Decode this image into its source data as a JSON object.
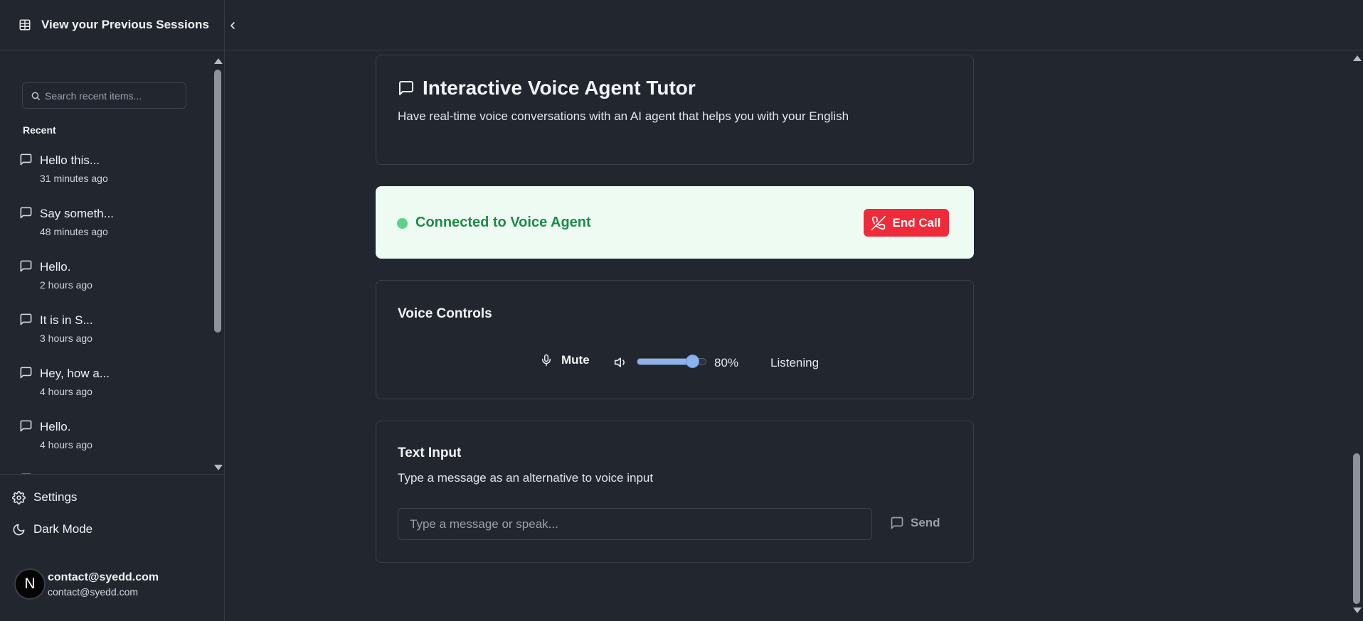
{
  "sidebar": {
    "header_title": "View your Previous Sessions",
    "search_placeholder": "Search recent items...",
    "recent_label": "Recent",
    "recent_items": [
      {
        "title": "Hello this...",
        "time": "31 minutes ago"
      },
      {
        "title": "Say someth...",
        "time": "48 minutes ago"
      },
      {
        "title": "Hello.",
        "time": "2 hours ago"
      },
      {
        "title": "It is in S...",
        "time": "3 hours ago"
      },
      {
        "title": "Hey, how a...",
        "time": "4 hours ago"
      },
      {
        "title": "Hello.",
        "time": "4 hours ago"
      }
    ],
    "settings_label": "Settings",
    "dark_mode_label": "Dark Mode",
    "user": {
      "avatar_initial": "N",
      "name": "contact@syedd.com",
      "email": "contact@syedd.com"
    }
  },
  "header_card": {
    "title": "Interactive Voice Agent Tutor",
    "description": "Have real-time voice conversations with an AI agent that helps you with your English"
  },
  "status": {
    "text": "Connected to Voice Agent",
    "end_call_label": "End Call"
  },
  "voice_controls": {
    "title": "Voice Controls",
    "mute_label": "Mute",
    "volume_value": "80%",
    "volume_level": 0.8,
    "state_text": "Listening"
  },
  "text_input": {
    "title": "Text Input",
    "description": "Type a message as an alternative to voice input",
    "placeholder": "Type a message or speak...",
    "send_label": "Send"
  },
  "colors": {
    "background": "#22262f",
    "status_bg": "#edfbf2",
    "status_text": "#1e8a45",
    "status_dot": "#5fd08c",
    "end_call": "#ef2b3a",
    "slider_accent": "#8ab4f0"
  },
  "icons": {
    "header": "sidebar-panel-icon",
    "collapse": "chevron-left-icon",
    "search": "search-icon",
    "recent_item": "message-square-icon",
    "settings": "gear-icon",
    "dark_mode": "moon-icon",
    "title": "message-square-icon",
    "end_call": "phone-off-icon",
    "mic": "mic-icon",
    "volume": "volume-icon",
    "send": "message-square-icon"
  }
}
